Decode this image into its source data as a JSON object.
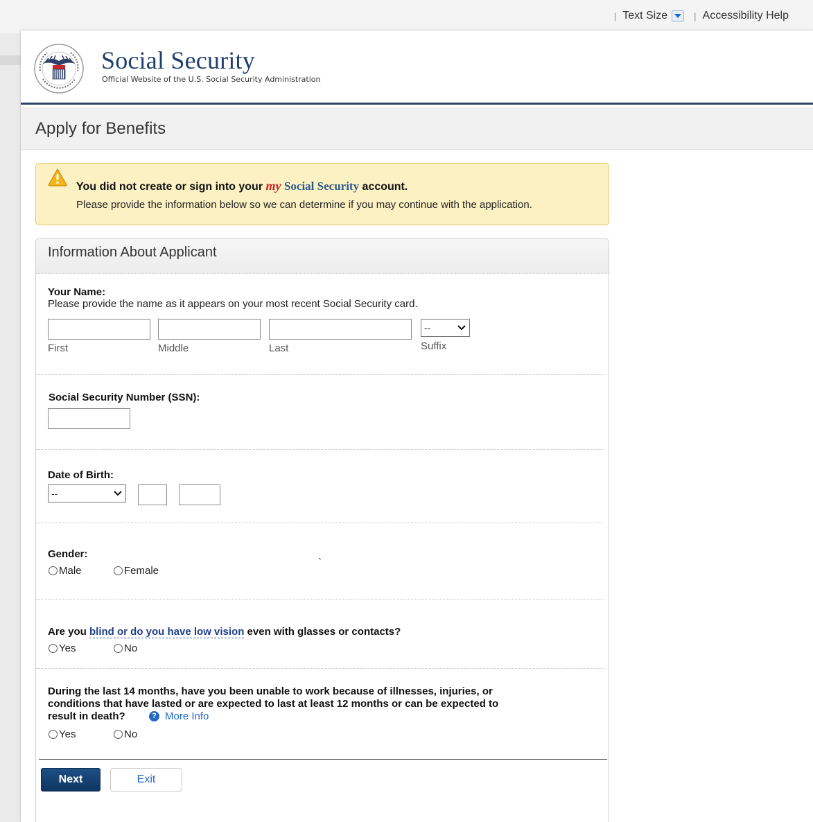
{
  "utility": {
    "separator": "|",
    "text_size": "Text Size",
    "accessibility_help": "Accessibility Help"
  },
  "header": {
    "title": "Social Security",
    "subtitle": "Official Website of the U.S. Social Security Administration",
    "seal_text": "SOCIAL SECURITY ADMINISTRATION USA"
  },
  "page": {
    "title": "Apply for Benefits"
  },
  "alert": {
    "line1_pre": "You did not create or sign into your ",
    "line1_my": "my",
    "line1_ss": "Social Security",
    "line1_post": " account.",
    "line2": "Please provide the information below so we can determine if you may continue with the application."
  },
  "panel": {
    "title": "Information About Applicant"
  },
  "name": {
    "label": "Your Name:",
    "note": "Please provide the name as it appears on your most recent Social Security card.",
    "first_label": "First",
    "middle_label": "Middle",
    "last_label": "Last",
    "suffix_label": "Suffix",
    "suffix_value": "--",
    "first_value": "",
    "middle_value": "",
    "last_value": ""
  },
  "ssn": {
    "label": "Social Security Number (SSN):",
    "value": ""
  },
  "dob": {
    "label": "Date of Birth:",
    "month_value": "--",
    "day_value": "",
    "year_value": ""
  },
  "gender": {
    "label": "Gender:",
    "male": "Male",
    "female": "Female",
    "stray_mark": "`"
  },
  "blind": {
    "pre": "Are you ",
    "link": "blind or do you have low vision",
    "post": " even with glasses or contacts?",
    "yes": "Yes",
    "no": "No"
  },
  "disability": {
    "line1": "During the last 14 months, have you been unable to work because of illnesses, injuries, or",
    "line2": "conditions that have lasted or are expected to last at least 12 months or can be expected to",
    "line3": "result in death?",
    "more_info": "More Info",
    "yes": "Yes",
    "no": "No"
  },
  "buttons": {
    "next": "Next",
    "exit": "Exit"
  },
  "colors": {
    "brand_navy": "#1f3f6e",
    "header_rule": "#2d4468",
    "alert_bg": "#fcf1c3",
    "link_blue": "#2468c5",
    "next_button": "#1d4f86"
  }
}
